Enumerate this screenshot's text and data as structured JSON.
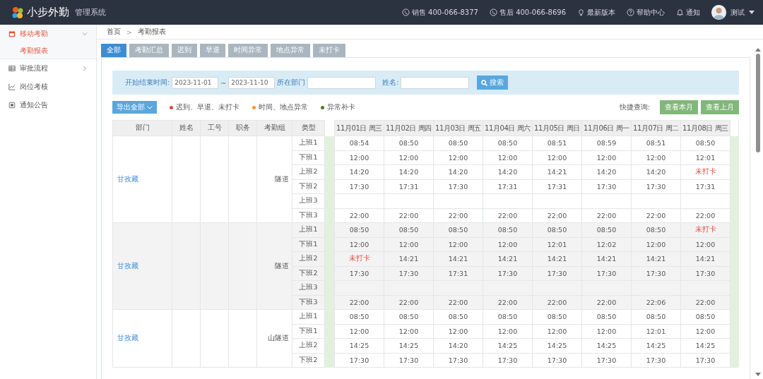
{
  "header": {
    "brand": "小步外勤",
    "subtitle": "管理系统",
    "links": [
      {
        "kind": "phone",
        "label": "销售 400-066-8377"
      },
      {
        "kind": "phone",
        "label": "售后 400-066-8696"
      },
      {
        "kind": "bulb",
        "label": "最新版本"
      },
      {
        "kind": "help",
        "label": "帮助中心"
      },
      {
        "kind": "bell",
        "label": "通知"
      }
    ],
    "user": "测试"
  },
  "sidebar": {
    "items": [
      {
        "label": "移动考勤",
        "selected": true,
        "expanded": true,
        "children": [
          {
            "label": "考勤报表",
            "selected": true
          }
        ]
      },
      {
        "label": "审批流程",
        "selected": false,
        "expanded": false
      },
      {
        "label": "岗位考核",
        "selected": false
      },
      {
        "label": "通知公告",
        "selected": false
      }
    ]
  },
  "breadcrumb": [
    "首页",
    ">",
    "考勤报表"
  ],
  "tabs": [
    {
      "label": "全部",
      "selected": true
    },
    {
      "label": "考勤汇总",
      "selected": false
    },
    {
      "label": "迟到",
      "selected": false
    },
    {
      "label": "早退",
      "selected": false
    },
    {
      "label": "时间异常",
      "selected": false
    },
    {
      "label": "地点异常",
      "selected": false
    },
    {
      "label": "未打卡",
      "selected": false
    }
  ],
  "filter": {
    "date_label": "开始结束时间:",
    "start": "2023-11-01",
    "sep": "~",
    "end": "2023-11-10",
    "dept_label": "所在部门",
    "name_label": "姓名:",
    "search": "搜索"
  },
  "toolbar": {
    "export": "导出全部",
    "legend": [
      {
        "label": "迟到、早退、未打卡",
        "color": "#e0483b"
      },
      {
        "label": "时间、地点异常",
        "color": "#f3962e"
      },
      {
        "label": "异常补卡",
        "color": "#557a1e"
      }
    ],
    "quick_label": "快捷查询:",
    "quick_buttons": [
      "查看本月",
      "查看上月"
    ]
  },
  "table": {
    "columns": [
      "部门",
      "姓名",
      "工号",
      "职务",
      "考勤组",
      "类型"
    ],
    "dates": [
      "11月01日 周三",
      "11月02日 周四",
      "11月03日 周五",
      "11月04日 周六",
      "11月05日 周日",
      "11月06日 周一",
      "11月07日 周二",
      "11月08日 周三"
    ],
    "groups": [
      {
        "dept": "甘孜藏",
        "team": "隧道",
        "rows": [
          {
            "type": "上班1",
            "times": [
              "08:54",
              "08:50",
              "08:50",
              "08:50",
              "08:51",
              "08:59",
              "08:51",
              "08:50"
            ],
            "alerts": [
              false,
              false,
              false,
              false,
              false,
              false,
              false,
              false
            ]
          },
          {
            "type": "下班1",
            "times": [
              "12:00",
              "12:00",
              "12:00",
              "12:00",
              "12:00",
              "12:00",
              "12:00",
              "12:01"
            ],
            "alerts": [
              false,
              false,
              false,
              false,
              false,
              false,
              false,
              false
            ]
          },
          {
            "type": "上班2",
            "times": [
              "14:20",
              "14:20",
              "14:20",
              "14:20",
              "14:21",
              "14:20",
              "14:20",
              "未打卡"
            ],
            "alerts": [
              false,
              false,
              false,
              false,
              false,
              false,
              false,
              true
            ]
          },
          {
            "type": "下班2",
            "times": [
              "17:30",
              "17:31",
              "17:30",
              "17:31",
              "17:31",
              "17:30",
              "17:30",
              "17:31"
            ],
            "alerts": [
              false,
              false,
              false,
              false,
              false,
              false,
              false,
              false
            ]
          },
          {
            "type": "上班3"
          },
          {
            "type": "下班3",
            "times": [
              "22:00",
              "22:00",
              "22:00",
              "22:00",
              "22:00",
              "22:00",
              "22:00",
              "22:00"
            ],
            "alerts": [
              false,
              false,
              false,
              false,
              false,
              false,
              false,
              false
            ]
          }
        ]
      },
      {
        "dept": "甘孜藏",
        "team": "隧道",
        "rows": [
          {
            "type": "上班1",
            "times": [
              "08:50",
              "08:50",
              "08:50",
              "08:50",
              "08:50",
              "08:50",
              "08:50",
              "未打卡"
            ],
            "alerts": [
              false,
              false,
              false,
              false,
              false,
              false,
              false,
              true
            ]
          },
          {
            "type": "下班1",
            "times": [
              "12:00",
              "12:00",
              "12:00",
              "12:00",
              "12:01",
              "12:02",
              "12:00",
              "12:00"
            ],
            "alerts": [
              false,
              false,
              false,
              false,
              false,
              false,
              false,
              false
            ]
          },
          {
            "type": "上班2",
            "times": [
              "未打卡",
              "14:21",
              "14:21",
              "14:21",
              "14:21",
              "14:21",
              "14:21",
              "14:21"
            ],
            "alerts": [
              true,
              false,
              false,
              false,
              false,
              false,
              false,
              false
            ]
          },
          {
            "type": "下班2",
            "times": [
              "17:30",
              "17:30",
              "17:31",
              "17:30",
              "17:30",
              "17:30",
              "17:30",
              "17:30"
            ],
            "alerts": [
              false,
              false,
              false,
              false,
              false,
              false,
              false,
              false
            ]
          },
          {
            "type": "上班3"
          },
          {
            "type": "下班3",
            "times": [
              "22:00",
              "22:00",
              "22:00",
              "22:00",
              "22:00",
              "22:00",
              "22:06",
              "22:00"
            ],
            "alerts": [
              false,
              false,
              false,
              false,
              false,
              false,
              false,
              false
            ]
          }
        ]
      },
      {
        "dept": "甘孜藏",
        "team": "山隧道",
        "rows": [
          {
            "type": "上班1",
            "times": [
              "08:50",
              "08:50",
              "08:50",
              "08:50",
              "08:50",
              "08:50",
              "08:50",
              "08:50"
            ],
            "alerts": [
              false,
              false,
              false,
              false,
              false,
              false,
              false,
              false
            ]
          },
          {
            "type": "下班1",
            "times": [
              "12:00",
              "12:00",
              "12:00",
              "12:00",
              "12:00",
              "12:00",
              "12:01",
              "12:00"
            ],
            "alerts": [
              false,
              false,
              false,
              false,
              false,
              false,
              false,
              false
            ]
          },
          {
            "type": "上班2",
            "times": [
              "14:25",
              "14:25",
              "14:20",
              "14:25",
              "14:25",
              "14:25",
              "14:25",
              "14:25"
            ],
            "alerts": [
              false,
              false,
              false,
              false,
              false,
              false,
              false,
              false
            ]
          },
          {
            "type": "下班2",
            "times": [
              "17:30",
              "17:30",
              "17:30",
              "17:30",
              "17:30",
              "17:30",
              "17:30",
              "17:30"
            ],
            "alerts": [
              false,
              false,
              false,
              false,
              false,
              false,
              false,
              false
            ]
          }
        ]
      }
    ]
  }
}
